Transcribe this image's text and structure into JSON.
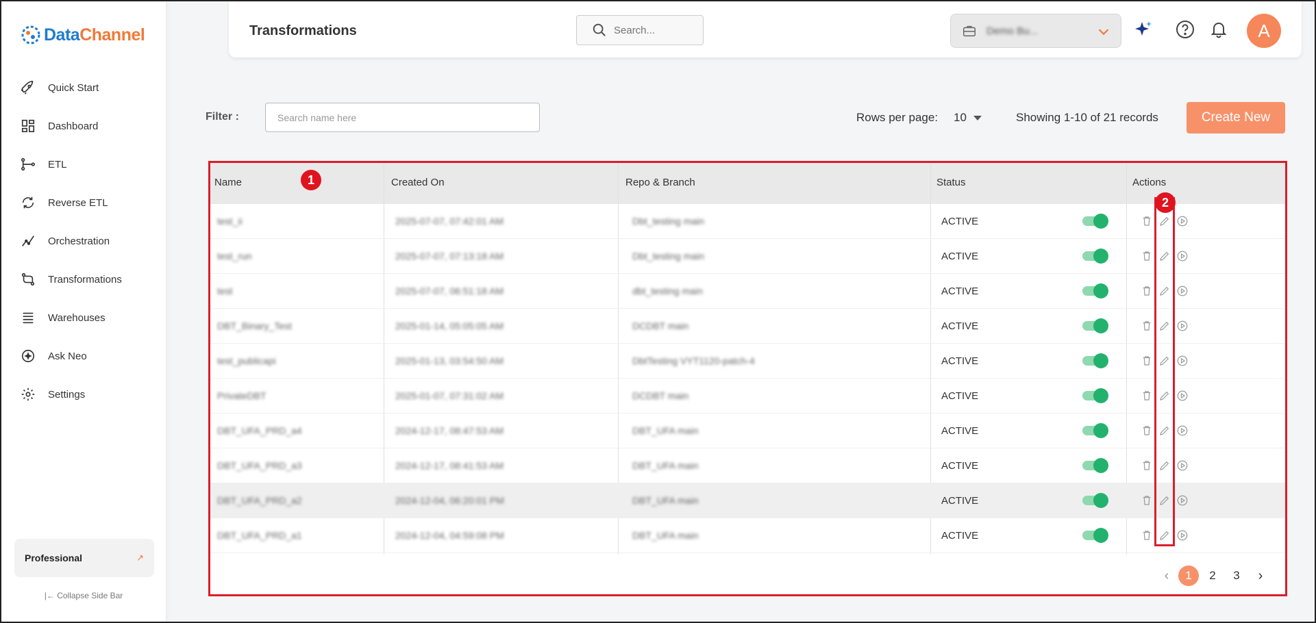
{
  "brand": {
    "name_part1": "Data",
    "name_part2": "Channel"
  },
  "sidebar": {
    "items": [
      {
        "label": "Quick Start",
        "icon": "rocket-icon"
      },
      {
        "label": "Dashboard",
        "icon": "dashboard-icon"
      },
      {
        "label": "ETL",
        "icon": "etl-icon"
      },
      {
        "label": "Reverse ETL",
        "icon": "reverse-etl-icon"
      },
      {
        "label": "Orchestration",
        "icon": "orchestration-icon"
      },
      {
        "label": "Transformations",
        "icon": "transformations-icon"
      },
      {
        "label": "Warehouses",
        "icon": "warehouses-icon"
      },
      {
        "label": "Ask Neo",
        "icon": "ask-neo-icon"
      },
      {
        "label": "Settings",
        "icon": "settings-icon"
      }
    ],
    "plan": "Professional",
    "collapse": "Collapse Side Bar"
  },
  "header": {
    "title": "Transformations",
    "search_placeholder": "Search...",
    "workspace": "Demo Bu..."
  },
  "toolbar": {
    "filter_label": "Filter :",
    "filter_placeholder": "Search name here",
    "rows_per_page_label": "Rows per page:",
    "rows_per_page_value": "10",
    "showing": "Showing 1-10 of 21 records",
    "create_label": "Create New"
  },
  "table": {
    "columns": [
      "Name",
      "Created On",
      "Repo & Branch",
      "Status",
      "Actions"
    ],
    "rows": [
      {
        "name": "test_ii",
        "created": "2025-07-07, 07:42:01 AM",
        "repo": "Dbt_testing  main",
        "status": "ACTIVE"
      },
      {
        "name": "test_run",
        "created": "2025-07-07, 07:13:18 AM",
        "repo": "Dbt_testing  main",
        "status": "ACTIVE"
      },
      {
        "name": "test",
        "created": "2025-07-07, 06:51:18 AM",
        "repo": "dbt_testing  main",
        "status": "ACTIVE"
      },
      {
        "name": "DBT_Binary_Test",
        "created": "2025-01-14, 05:05:05 AM",
        "repo": "DCDBT  main",
        "status": "ACTIVE"
      },
      {
        "name": "test_publicapi",
        "created": "2025-01-13, 03:54:50 AM",
        "repo": "DbtTesting  VYT1120-patch-4",
        "status": "ACTIVE"
      },
      {
        "name": "PrivateDBT",
        "created": "2025-01-07, 07:31:02 AM",
        "repo": "DCDBT  main",
        "status": "ACTIVE"
      },
      {
        "name": "DBT_UFA_PRD_a4",
        "created": "2024-12-17, 08:47:53 AM",
        "repo": "DBT_UFA  main",
        "status": "ACTIVE"
      },
      {
        "name": "DBT_UFA_PRD_a3",
        "created": "2024-12-17, 08:41:53 AM",
        "repo": "DBT_UFA  main",
        "status": "ACTIVE"
      },
      {
        "name": "DBT_UFA_PRD_a2",
        "created": "2024-12-04, 06:20:01 PM",
        "repo": "DBT_UFA  main",
        "status": "ACTIVE"
      },
      {
        "name": "DBT_UFA_PRD_a1",
        "created": "2024-12-04, 04:59:08 PM",
        "repo": "DBT_UFA  main",
        "status": "ACTIVE"
      }
    ]
  },
  "pagination": {
    "pages": [
      "1",
      "2",
      "3"
    ],
    "current": "1"
  },
  "callouts": [
    "1",
    "2"
  ],
  "colors": {
    "accent": "#f7916a",
    "toggle_on": "#23b26d",
    "highlight": "#d91e2a"
  }
}
